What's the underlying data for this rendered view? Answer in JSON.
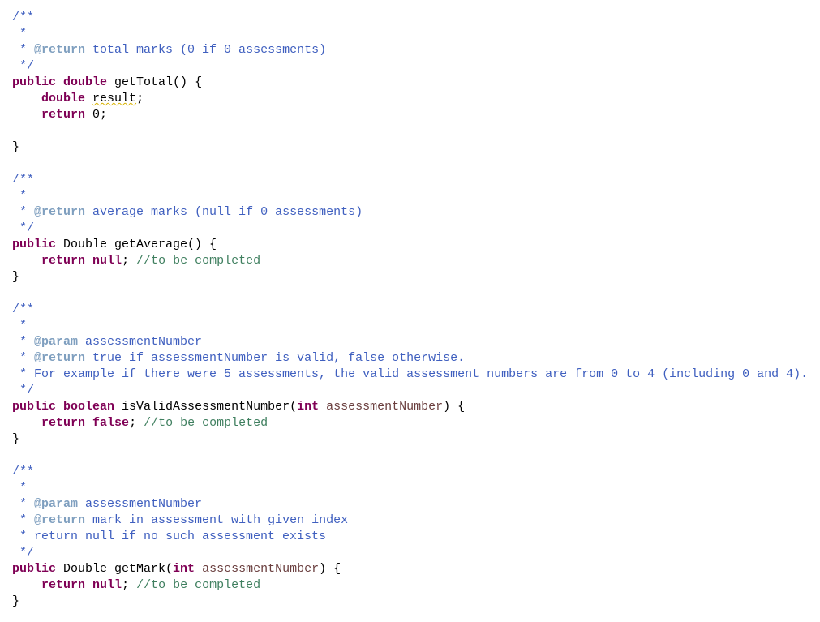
{
  "editor": {
    "lines": [
      [
        {
          "t": "/**",
          "c": "cmt"
        }
      ],
      [
        {
          "t": " *",
          "c": "cmt"
        }
      ],
      [
        {
          "t": " * ",
          "c": "cmt"
        },
        {
          "t": "@return",
          "c": "tag"
        },
        {
          "t": " total marks (0 if 0 assessments)",
          "c": "jd"
        }
      ],
      [
        {
          "t": " */",
          "c": "cmt"
        }
      ],
      [
        {
          "t": "public",
          "c": "kw"
        },
        {
          "t": " "
        },
        {
          "t": "double",
          "c": "kw"
        },
        {
          "t": " getTotal() {"
        }
      ],
      [
        {
          "t": "    "
        },
        {
          "t": "double",
          "c": "kw"
        },
        {
          "t": " "
        },
        {
          "t": "result",
          "c": "warn"
        },
        {
          "t": ";"
        }
      ],
      [
        {
          "t": "    "
        },
        {
          "t": "return",
          "c": "kw"
        },
        {
          "t": " 0;"
        }
      ],
      [
        {
          "t": ""
        }
      ],
      [
        {
          "t": "}"
        }
      ],
      [
        {
          "t": ""
        }
      ],
      [
        {
          "t": "/**",
          "c": "cmt"
        }
      ],
      [
        {
          "t": " *",
          "c": "cmt"
        }
      ],
      [
        {
          "t": " * ",
          "c": "cmt"
        },
        {
          "t": "@return",
          "c": "tag"
        },
        {
          "t": " average marks (null if 0 assessments)",
          "c": "jd"
        }
      ],
      [
        {
          "t": " */",
          "c": "cmt"
        }
      ],
      [
        {
          "t": "public",
          "c": "kw"
        },
        {
          "t": " Double getAverage() {"
        }
      ],
      [
        {
          "t": "    "
        },
        {
          "t": "return",
          "c": "kw"
        },
        {
          "t": " "
        },
        {
          "t": "null",
          "c": "kw"
        },
        {
          "t": "; "
        },
        {
          "t": "//to be completed",
          "c": "cm"
        }
      ],
      [
        {
          "t": "}"
        }
      ],
      [
        {
          "t": ""
        }
      ],
      [
        {
          "t": "/**",
          "c": "cmt"
        }
      ],
      [
        {
          "t": " *",
          "c": "cmt"
        }
      ],
      [
        {
          "t": " * ",
          "c": "cmt"
        },
        {
          "t": "@param",
          "c": "tag"
        },
        {
          "t": " assessmentNumber",
          "c": "jd"
        }
      ],
      [
        {
          "t": " * ",
          "c": "cmt"
        },
        {
          "t": "@return",
          "c": "tag"
        },
        {
          "t": " true if assessmentNumber is valid, false otherwise.",
          "c": "jd"
        }
      ],
      [
        {
          "t": " * For example if there were 5 assessments, the valid assessment numbers are from 0 to 4 (including 0 and 4).",
          "c": "jd"
        }
      ],
      [
        {
          "t": " */",
          "c": "cmt"
        }
      ],
      [
        {
          "t": "public",
          "c": "kw"
        },
        {
          "t": " "
        },
        {
          "t": "boolean",
          "c": "kw"
        },
        {
          "t": " isValidAssessmentNumber("
        },
        {
          "t": "int",
          "c": "kw"
        },
        {
          "t": " "
        },
        {
          "t": "assessmentNumber",
          "c": "param"
        },
        {
          "t": ") {"
        }
      ],
      [
        {
          "t": "    "
        },
        {
          "t": "return",
          "c": "kw"
        },
        {
          "t": " "
        },
        {
          "t": "false",
          "c": "kw"
        },
        {
          "t": "; "
        },
        {
          "t": "//to be completed",
          "c": "cm"
        }
      ],
      [
        {
          "t": "}"
        }
      ],
      [
        {
          "t": ""
        }
      ],
      [
        {
          "t": "/**",
          "c": "cmt"
        }
      ],
      [
        {
          "t": " *",
          "c": "cmt"
        }
      ],
      [
        {
          "t": " * ",
          "c": "cmt"
        },
        {
          "t": "@param",
          "c": "tag"
        },
        {
          "t": " assessmentNumber",
          "c": "jd"
        }
      ],
      [
        {
          "t": " * ",
          "c": "cmt"
        },
        {
          "t": "@return",
          "c": "tag"
        },
        {
          "t": " mark in assessment with given index",
          "c": "jd"
        }
      ],
      [
        {
          "t": " * return null if no such assessment exists",
          "c": "jd"
        }
      ],
      [
        {
          "t": " */",
          "c": "cmt"
        }
      ],
      [
        {
          "t": "public",
          "c": "kw"
        },
        {
          "t": " Double getMark("
        },
        {
          "t": "int",
          "c": "kw"
        },
        {
          "t": " "
        },
        {
          "t": "assessmentNumber",
          "c": "param"
        },
        {
          "t": ") {"
        }
      ],
      [
        {
          "t": "    "
        },
        {
          "t": "return",
          "c": "kw"
        },
        {
          "t": " "
        },
        {
          "t": "null",
          "c": "kw"
        },
        {
          "t": "; "
        },
        {
          "t": "//to be completed",
          "c": "cm"
        }
      ],
      [
        {
          "t": "}"
        }
      ]
    ]
  }
}
